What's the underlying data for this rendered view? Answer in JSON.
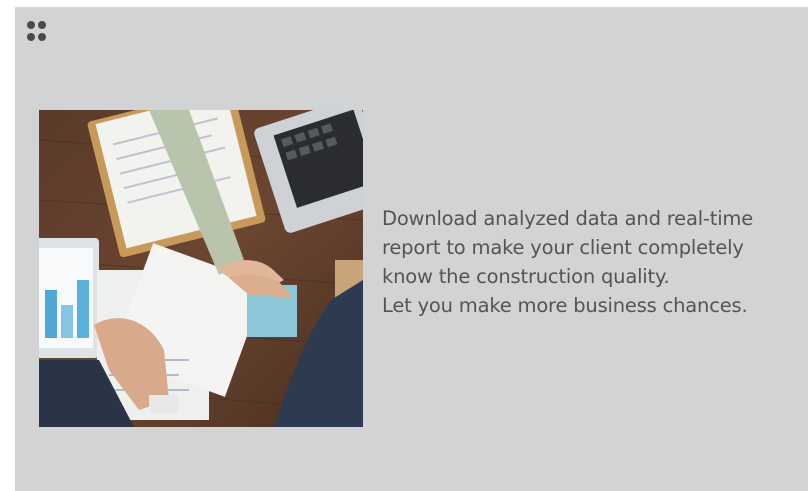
{
  "menu_icon": "grid-dots-icon",
  "image": {
    "subject": "handshake-photo"
  },
  "description": {
    "lines": [
      "Download analyzed data and real-time",
      "report to make your client completely",
      "know the construction quality.",
      "Let you make more business chances."
    ]
  },
  "colors": {
    "panel": "#d2d3d5",
    "text": "#545454",
    "icon": "#4a4a4a"
  }
}
